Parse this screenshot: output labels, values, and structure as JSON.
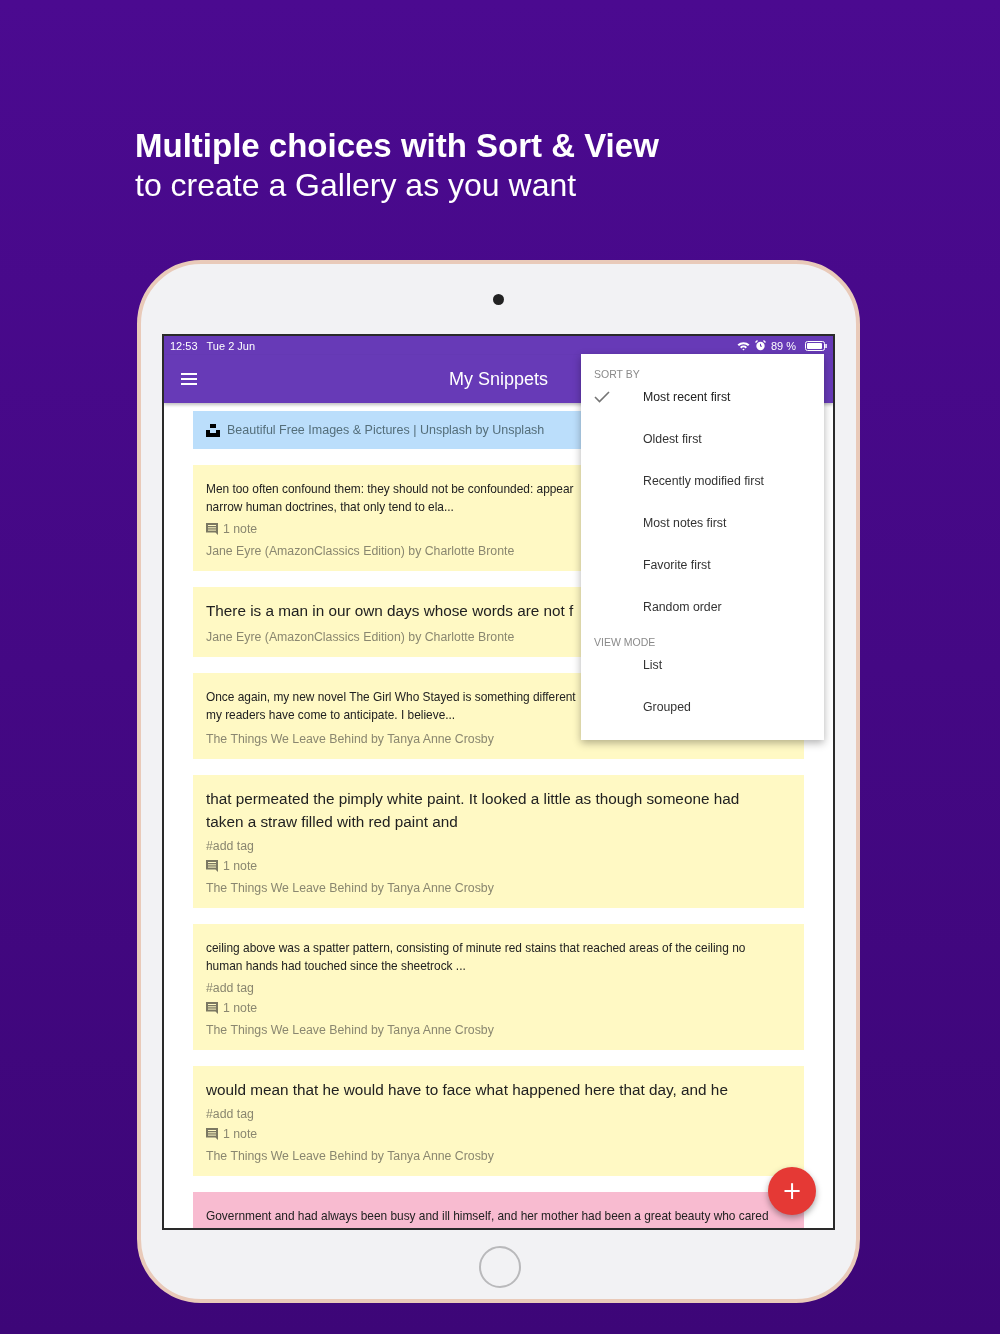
{
  "headline": {
    "title": "Multiple choices with Sort & View",
    "subtitle": "to create a Gallery as you want"
  },
  "status_bar": {
    "time": "12:53",
    "date": "Tue 2 Jun",
    "battery": "89 %"
  },
  "toolbar": {
    "title": "My Snippets"
  },
  "cards": [
    {
      "kind": "link",
      "color": "#bbdefb",
      "lines": [
        "Beautiful Free Images & Pictures | Unsplash by Unsplash"
      ]
    },
    {
      "kind": "small",
      "color": "#fff9c4",
      "lines": [
        "Men too often confound them: they should not be confounded: appear",
        "narrow human doctrines, that only tend to ela..."
      ],
      "notes": "1 note",
      "source": "Jane Eyre (AmazonClassics Edition) by Charlotte Bronte"
    },
    {
      "kind": "large",
      "color": "#fff9c4",
      "lines": [
        "There is a man in our own days whose words are not f"
      ],
      "source": "Jane Eyre (AmazonClassics Edition) by Charlotte Bronte"
    },
    {
      "kind": "small",
      "color": "#fff9c4",
      "lines": [
        "Once again, my new novel The Girl Who Stayed is something different",
        "my readers have come to anticipate. I believe..."
      ],
      "source": "The Things We Leave Behind by Tanya Anne Crosby"
    },
    {
      "kind": "large",
      "color": "#fff9c4",
      "lines": [
        "that permeated the pimply white paint. It looked a little as though someone had",
        "taken a straw filled with red paint and"
      ],
      "tag": "#add tag",
      "notes": "1 note",
      "source": "The Things We Leave Behind by Tanya Anne Crosby"
    },
    {
      "kind": "small",
      "color": "#fff9c4",
      "lines": [
        "ceiling above was a spatter pattern, consisting of minute red stains that reached areas of the ceiling no",
        "human hands had touched since the sheetrock ..."
      ],
      "tag": "#add tag",
      "notes": "1 note",
      "source": "The Things We Leave Behind by Tanya Anne Crosby"
    },
    {
      "kind": "large",
      "color": "#fff9c4",
      "lines": [
        "would mean that he would have to face what happened here that day, and he"
      ],
      "tag": "#add tag",
      "notes": "1 note",
      "source": "The Things We Leave Behind by Tanya Anne Crosby"
    },
    {
      "kind": "small",
      "color": "#f8bbd0",
      "lines": [
        "Government and had always been busy and ill himself, and her mother had been a great beauty who cared"
      ]
    }
  ],
  "menu": [
    {
      "title": "SORT BY",
      "options": [
        {
          "label": "Most recent first",
          "selected": true
        },
        {
          "label": "Oldest first",
          "selected": false
        },
        {
          "label": "Recently modified first",
          "selected": false
        },
        {
          "label": "Most notes first",
          "selected": false
        },
        {
          "label": "Favorite first",
          "selected": false
        },
        {
          "label": "Random order",
          "selected": false
        }
      ]
    },
    {
      "title": "VIEW MODE",
      "options": [
        {
          "label": "List",
          "selected": false
        },
        {
          "label": "Grouped",
          "selected": false
        }
      ]
    }
  ],
  "fab": {
    "label": "+"
  }
}
